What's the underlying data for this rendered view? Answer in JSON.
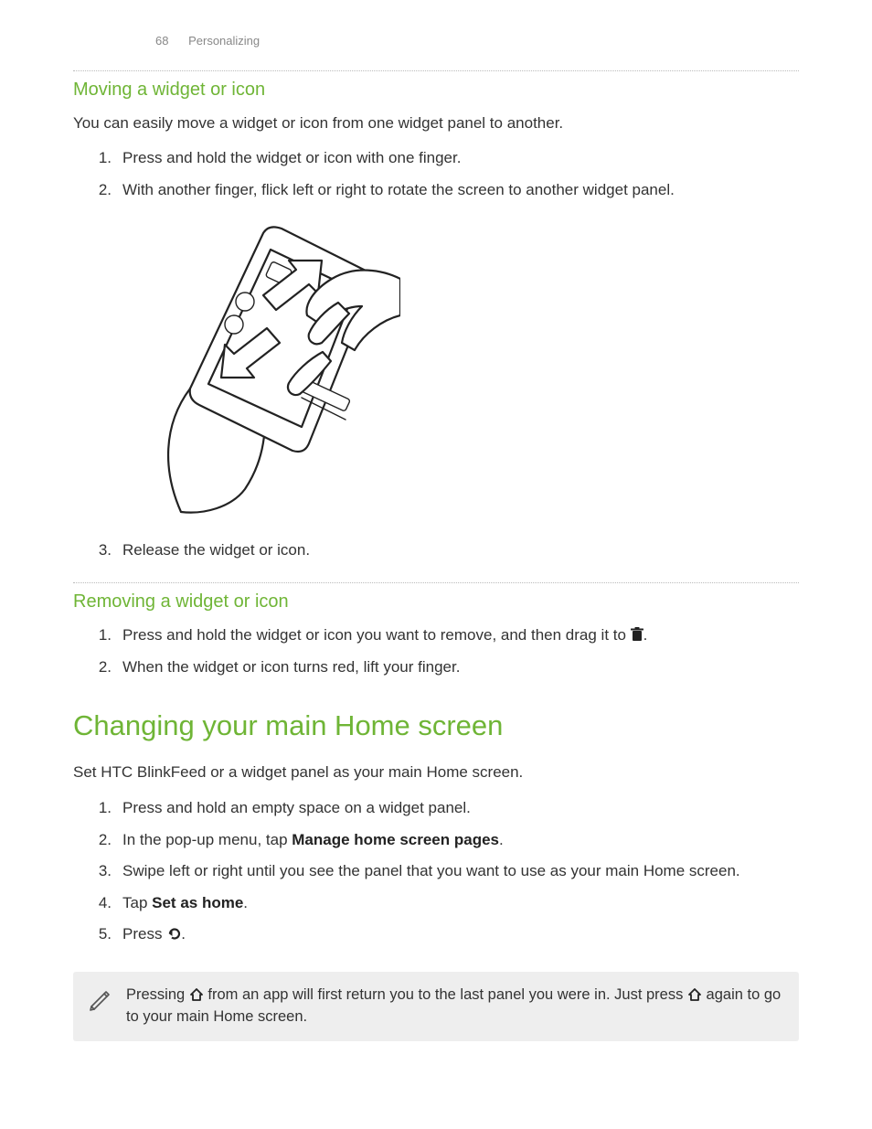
{
  "runhead": {
    "page_number": "68",
    "section": "Personalizing"
  },
  "section1": {
    "heading": "Moving a widget or icon",
    "intro": "You can easily move a widget or icon from one widget panel to another.",
    "steps": {
      "s1": {
        "n": "1.",
        "t": "Press and hold the widget or icon with one finger."
      },
      "s2": {
        "n": "2.",
        "t": "With another finger, flick left or right to rotate the screen to another widget panel."
      },
      "s3": {
        "n": "3.",
        "t": "Release the widget or icon."
      }
    }
  },
  "section2": {
    "heading": "Removing a widget or icon",
    "steps": {
      "s1": {
        "n": "1.",
        "pre": "Press and hold the widget or icon you want to remove, and then drag it to ",
        "post": "."
      },
      "s2": {
        "n": "2.",
        "t": "When the widget or icon turns red, lift your finger."
      }
    }
  },
  "section3": {
    "heading": "Changing your main Home screen",
    "intro": "Set HTC BlinkFeed or a widget panel as your main Home screen.",
    "steps": {
      "s1": {
        "n": "1.",
        "t": "Press and hold an empty space on a widget panel."
      },
      "s2": {
        "n": "2.",
        "pre": "In the pop-up menu, tap ",
        "bold": "Manage home screen pages",
        "post": "."
      },
      "s3": {
        "n": "3.",
        "t": "Swipe left or right until you see the panel that you want to use as your main Home screen."
      },
      "s4": {
        "n": "4.",
        "pre": "Tap ",
        "bold": "Set as home",
        "post": "."
      },
      "s5": {
        "n": "5.",
        "pre": "Press ",
        "post": "."
      }
    }
  },
  "note": {
    "pre": "Pressing ",
    "mid": " from an app will first return you to the last panel you were in. Just press ",
    "post": " again to go to your main Home screen."
  }
}
